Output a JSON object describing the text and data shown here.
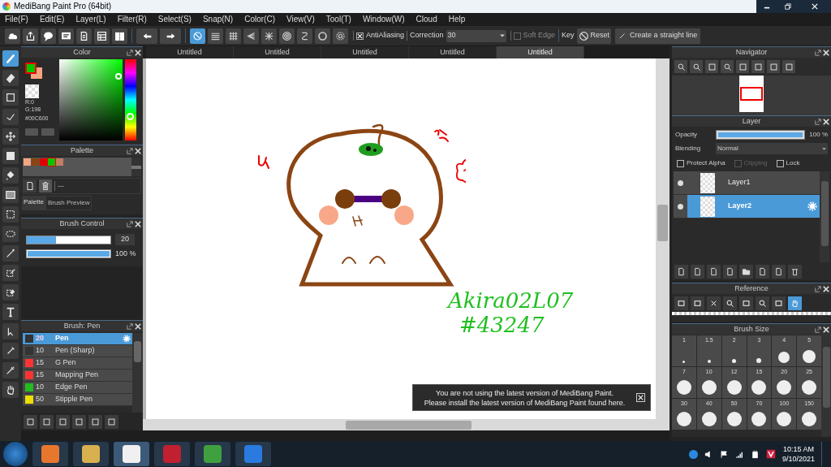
{
  "window": {
    "title": "MediBang Paint Pro (64bit)"
  },
  "menu": [
    "File(F)",
    "Edit(E)",
    "Layer(L)",
    "Filter(R)",
    "Select(S)",
    "Snap(N)",
    "Color(C)",
    "View(V)",
    "Tool(T)",
    "Window(W)",
    "Cloud",
    "Help"
  ],
  "toolbar": {
    "snap_modes": [
      {
        "kind": "off",
        "selected": true
      },
      {
        "kind": "parallel",
        "selected": false
      },
      {
        "kind": "grid",
        "selected": false
      },
      {
        "kind": "perspective",
        "selected": false
      },
      {
        "kind": "radial",
        "selected": false
      },
      {
        "kind": "concentric",
        "selected": false
      },
      {
        "kind": "curve",
        "selected": false
      },
      {
        "kind": "circle",
        "selected": false
      },
      {
        "kind": "settings",
        "selected": false
      }
    ],
    "antialiasing": {
      "label": "AntiAliasing",
      "checked": true
    },
    "correction": {
      "label": "Correction",
      "value": "30"
    },
    "soft_edge": {
      "label": "Soft Edge",
      "checked": false
    },
    "key_label": "Key",
    "reset": "Reset",
    "straight_line": "Create a straight line"
  },
  "tools": [
    {
      "kind": "brush",
      "selected": true
    },
    {
      "kind": "eraser",
      "selected": false
    },
    {
      "kind": "shape",
      "selected": false
    },
    {
      "kind": "dot-line",
      "selected": false
    },
    {
      "kind": "move",
      "selected": false
    },
    {
      "kind": "fill",
      "selected": false
    },
    {
      "kind": "bucket",
      "selected": false
    },
    {
      "kind": "gradient",
      "selected": false
    },
    {
      "kind": "select",
      "selected": false
    },
    {
      "kind": "lasso",
      "selected": false
    },
    {
      "kind": "wand",
      "selected": false
    },
    {
      "kind": "select-pen",
      "selected": false
    },
    {
      "kind": "select-eraser",
      "selected": false
    },
    {
      "kind": "text",
      "selected": false
    },
    {
      "kind": "divide",
      "selected": false
    },
    {
      "kind": "dropper",
      "selected": false
    },
    {
      "kind": "eyedropper",
      "selected": false
    },
    {
      "kind": "hand",
      "selected": false
    }
  ],
  "color_panel": {
    "title": "Color",
    "readout": [
      "R:0",
      "G:198"
    ],
    "hex": "#00C600"
  },
  "palette": {
    "title": "Palette",
    "swatches": [
      {
        "color": "#f4a582",
        "selected": false
      },
      {
        "color": "#8b4513",
        "selected": false
      },
      {
        "color": "#e00000",
        "selected": false
      },
      {
        "color": "#00c600",
        "selected": true
      },
      {
        "color": "#c08060",
        "selected": false
      }
    ],
    "name": "---",
    "tabs": [
      {
        "label": "Palette",
        "selected": true
      },
      {
        "label": "Brush Preview",
        "selected": false
      }
    ]
  },
  "brush_control": {
    "title": "Brush Control",
    "size": {
      "level": 0.35,
      "value": "20"
    },
    "opacity": {
      "level": 1,
      "value": "100 %"
    }
  },
  "brush_list": {
    "title": "Brush: Pen",
    "items": [
      {
        "color": "#333333",
        "size": "20",
        "name": "Pen",
        "selected": true
      },
      {
        "color": "#333333",
        "size": "10",
        "name": "Pen (Sharp)",
        "selected": false
      },
      {
        "color": "#ff3333",
        "size": "15",
        "name": "G Pen",
        "selected": false
      },
      {
        "color": "#ff3333",
        "size": "15",
        "name": "Mapping Pen",
        "selected": false
      },
      {
        "color": "#22bb22",
        "size": "10",
        "name": "Edge Pen",
        "selected": false
      },
      {
        "color": "#eedd00",
        "size": "50",
        "name": "Stipple Pen",
        "selected": false
      }
    ]
  },
  "canvas_tabs": [
    {
      "label": "Untitled",
      "selected": false
    },
    {
      "label": "Untitled",
      "selected": false
    },
    {
      "label": "Untitled",
      "selected": false
    },
    {
      "label": "Untitled",
      "selected": false
    },
    {
      "label": "Untitled",
      "selected": true
    }
  ],
  "canvas": {
    "signature": [
      "Akira02L07",
      "#43247"
    ]
  },
  "notification": {
    "lines": [
      "You are not using the latest version of MediBang Paint.",
      "Please install the latest version of MediBang Paint found here."
    ]
  },
  "navigator": {
    "title": "Navigator"
  },
  "layer_panel": {
    "title": "Layer",
    "opacity": {
      "label": "Opacity",
      "level": 1,
      "value": "100 %"
    },
    "blending": {
      "label": "Blending",
      "value": "Normal"
    },
    "options": [
      {
        "label": "Protect Alpha",
        "checked": false,
        "disabled": false
      },
      {
        "label": "Clipping",
        "checked": false,
        "disabled": true
      },
      {
        "label": "Lock",
        "checked": false,
        "disabled": false
      }
    ],
    "layers": [
      {
        "name": "Layer1",
        "selected": false,
        "visible": true
      },
      {
        "name": "Layer2",
        "selected": true,
        "visible": true
      }
    ]
  },
  "reference": {
    "title": "Reference"
  },
  "brush_size": {
    "title": "Brush Size",
    "sizes": [
      "1",
      "1.5",
      "2",
      "3",
      "4",
      "5",
      "7",
      "10",
      "12",
      "15",
      "20",
      "25",
      "30",
      "40",
      "50",
      "70",
      "100",
      "150"
    ]
  },
  "taskbar": {
    "time": "10:15 AM",
    "date": "9/10/2021"
  }
}
